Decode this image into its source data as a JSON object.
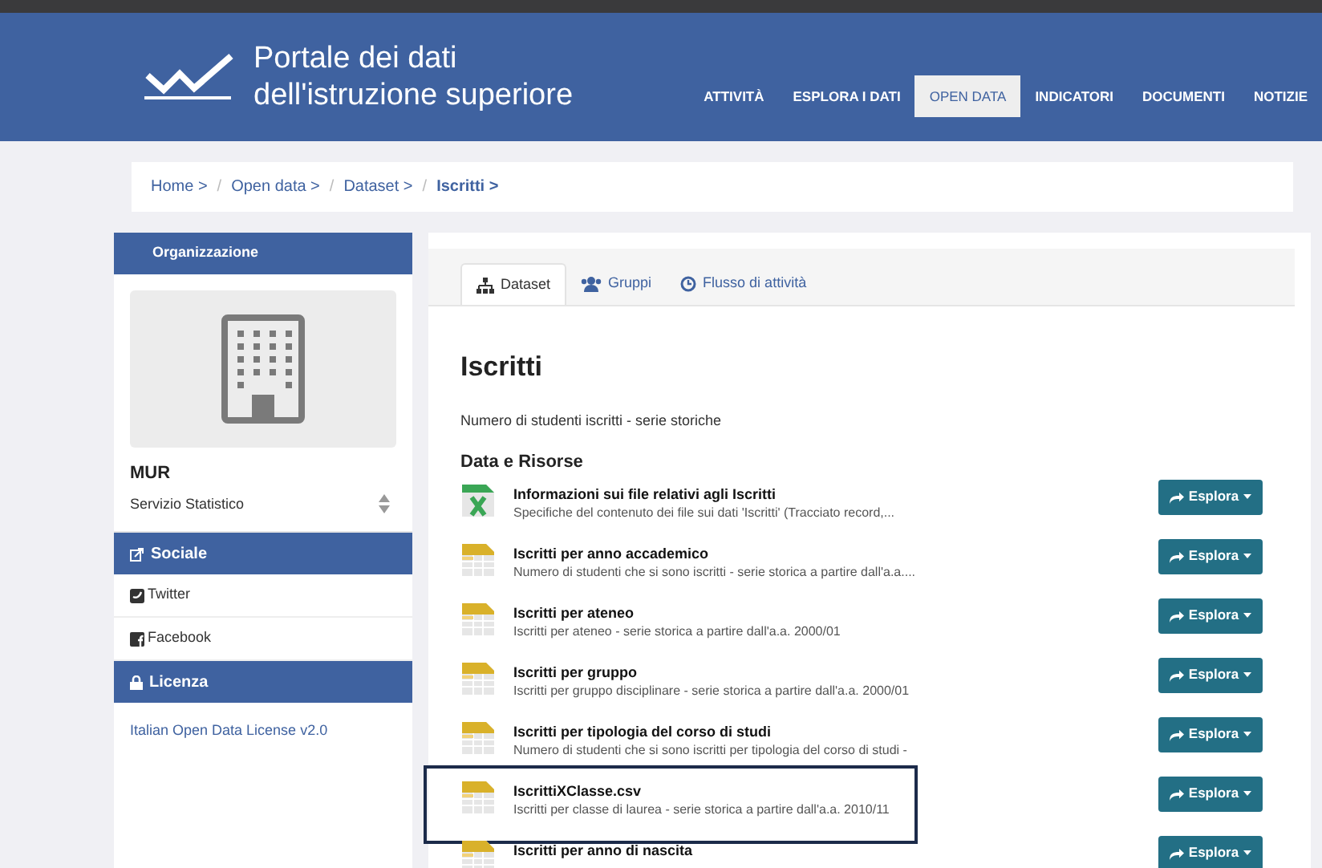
{
  "header": {
    "title_line_1": "Portale dei dati",
    "title_line_2": "dell'istruzione superiore"
  },
  "nav": [
    {
      "label": "ATTIVITÀ",
      "selected": false
    },
    {
      "label": "ESPLORA I DATI",
      "selected": false
    },
    {
      "label": "OPEN DATA",
      "selected": true
    },
    {
      "label": "INDICATORI",
      "selected": false
    },
    {
      "label": "DOCUMENTI",
      "selected": false
    },
    {
      "label": "NOTIZIE",
      "selected": false
    }
  ],
  "breadcrumb": [
    {
      "label": "Home >",
      "current": false
    },
    {
      "separator": "/",
      "label": "Open data >",
      "current": false
    },
    {
      "separator": "/",
      "label": "Dataset >",
      "current": false
    },
    {
      "separator": "/",
      "label": "Iscritti >",
      "current": true
    }
  ],
  "sidebar": {
    "organization_heading": "Organizzazione",
    "org_name": "MUR",
    "org_unit": "Servizio Statistico",
    "social_heading": "Sociale",
    "social_links": [
      {
        "kind": "twitter",
        "label": "Twitter"
      },
      {
        "kind": "facebook",
        "label": "Facebook"
      }
    ],
    "license_heading": "Licenza",
    "license_link": "Italian Open Data License v2.0"
  },
  "tabs": [
    {
      "kind": "dataset",
      "label": "Dataset",
      "selected": true
    },
    {
      "kind": "groups",
      "label": "Gruppi",
      "selected": false
    },
    {
      "kind": "activity",
      "label": "Flusso di attività",
      "selected": false
    }
  ],
  "dataset": {
    "title": "Iscritti",
    "description": "Numero di studenti iscritti - serie storiche",
    "resources_heading": "Data e Risorse"
  },
  "resources": [
    {
      "kind": "xls",
      "title": "Informazioni sui file relativi agli Iscritti",
      "description": "Specifiche del contenuto dei file sui dati 'Iscritti' (Tracciato record,...",
      "button": "Esplora",
      "highlighted": false
    },
    {
      "kind": "csv",
      "title": "Iscritti per anno accademico",
      "description": "Numero di studenti che si sono iscritti - serie storica a partire dall'a.a....",
      "button": "Esplora",
      "highlighted": false
    },
    {
      "kind": "csv",
      "title": "Iscritti per ateneo",
      "description": "Iscritti per ateneo - serie storica a partire dall'a.a. 2000/01",
      "button": "Esplora",
      "highlighted": false
    },
    {
      "kind": "csv",
      "title": "Iscritti per gruppo",
      "description": "Iscritti per gruppo disciplinare - serie storica a partire dall'a.a. 2000/01",
      "button": "Esplora",
      "highlighted": false
    },
    {
      "kind": "csv",
      "title": "Iscritti per tipologia del corso di studi",
      "description": "Numero di studenti che si sono iscritti per tipologia del corso di studi -",
      "button": "Esplora",
      "highlighted": false
    },
    {
      "kind": "csv",
      "title": "IscrittiXClasse.csv",
      "description": "Iscritti per classe di laurea - serie storica a partire dall'a.a. 2010/11",
      "button": "Esplora",
      "highlighted": true
    },
    {
      "kind": "csv",
      "title": "Iscritti per anno di nascita",
      "button": "Esplora",
      "highlighted": false
    }
  ]
}
